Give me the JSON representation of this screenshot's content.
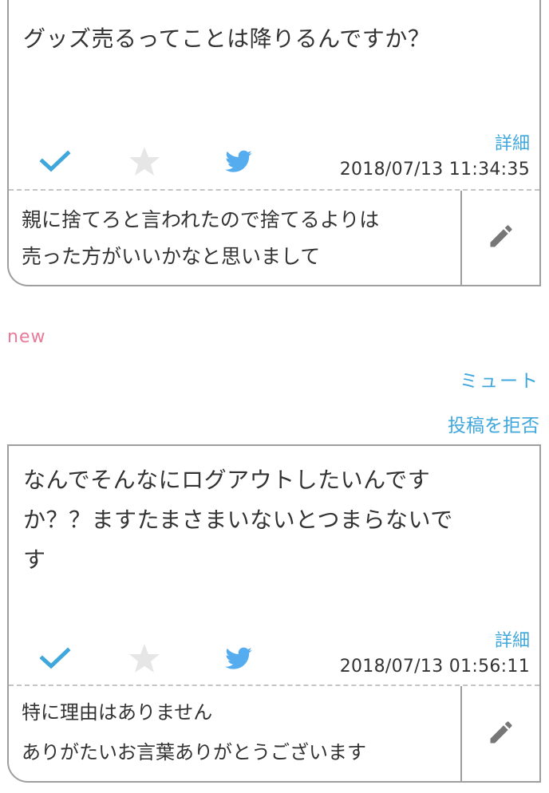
{
  "colors": {
    "accent": "#3fa7dc",
    "new": "#ea7a9a",
    "border": "#9e9e9e",
    "star": "#e6e6e6"
  },
  "posts": [
    {
      "question": "グッズ売るってことは降りるんですか？",
      "detail_label": "詳細",
      "timestamp": "2018/07/13 11:34:35",
      "answer_lines": [
        "親に捨てろと言われたので捨てるよりは",
        "売った方がいいかなと思いまして"
      ],
      "icons": [
        "check-icon",
        "star-icon",
        "twitter-bird-icon",
        "pencil-icon"
      ]
    },
    {
      "question": "なんでそんなにログアウトしたいんです\nか？？ますたまさまいないとつまらないで\nす",
      "question_lines": [
        "なんでそんなにログアウトしたいんです",
        "か？？ますたまさまいないとつまらないで",
        "す"
      ],
      "detail_label": "詳細",
      "timestamp": "2018/07/13 01:56:11",
      "answer_lines": [
        "特に理由はありません",
        "ありがたいお言葉ありがとうございます"
      ],
      "icons": [
        "check-icon",
        "star-icon",
        "twitter-bird-icon",
        "pencil-icon"
      ]
    }
  ],
  "new_label": "new",
  "mute_label": "ミュート",
  "reject_label": "投稿を拒否"
}
